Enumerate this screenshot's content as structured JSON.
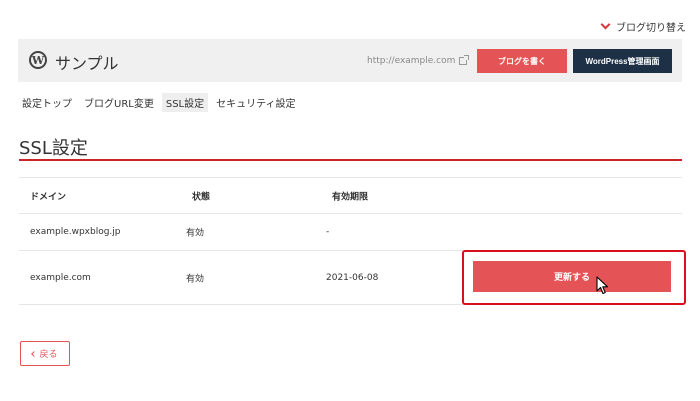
{
  "blog_switch": {
    "label": "ブログ切り替え"
  },
  "header": {
    "logo_glyph": "W",
    "site_name": "サンプル",
    "site_url": "http://example.com",
    "write_button": "ブログを書く",
    "admin_button": "WordPress管理画面"
  },
  "tabs": [
    {
      "label": "設定トップ",
      "active": false
    },
    {
      "label": "ブログURL変更",
      "active": false
    },
    {
      "label": "SSL設定",
      "active": true
    },
    {
      "label": "セキュリティ設定",
      "active": false
    }
  ],
  "section": {
    "title": "SSL設定"
  },
  "table": {
    "headers": {
      "domain": "ドメイン",
      "status": "状態",
      "expiry": "有効期限"
    },
    "rows": [
      {
        "domain": "example.wpxblog.jp",
        "status": "有効",
        "expiry": "-"
      },
      {
        "domain": "example.com",
        "status": "有効",
        "expiry": "2021-06-08",
        "action": "更新する"
      }
    ]
  },
  "back_button": {
    "label": "戻る"
  },
  "colors": {
    "accent": "#e45456",
    "dark": "#1d3046",
    "highlight": "#d80f1d",
    "rule": "#c8262c"
  }
}
